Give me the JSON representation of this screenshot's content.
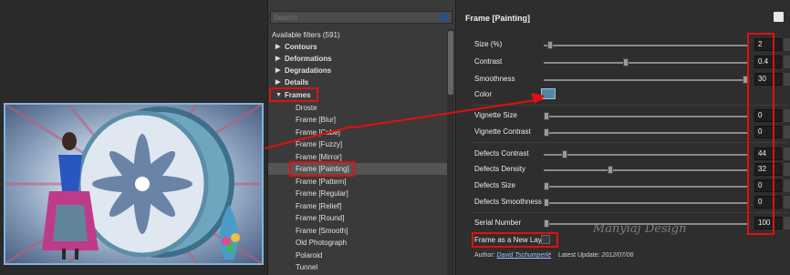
{
  "tree": {
    "search_placeholder": "Search",
    "available": "Available filters (591)",
    "categories": [
      "Contours",
      "Deformations",
      "Degradations",
      "Details",
      "Frames"
    ],
    "frames": [
      "Droste",
      "Frame [Blur]",
      "Frame [Cube]",
      "Frame [Fuzzy]",
      "Frame [Mirror]",
      "Frame [Painting]",
      "Frame [Pattern]",
      "Frame [Regular]",
      "Frame [Relief]",
      "Frame [Round]",
      "Frame [Smooth]",
      "Old Photograph",
      "Polaroid",
      "Tunnel"
    ],
    "selected": "Frame [Painting]"
  },
  "settings": {
    "title": "Frame [Painting]",
    "params": [
      {
        "label": "Size (%)",
        "value": "2",
        "pos": 0.02
      },
      {
        "label": "Contrast",
        "value": "0.4",
        "pos": 0.4
      },
      {
        "label": "Smoothness",
        "value": "30",
        "pos": 1.0
      },
      {
        "label": "Color",
        "value": "",
        "pos": null
      },
      {
        "label": "Vignette Size",
        "value": "0",
        "pos": 0.0
      },
      {
        "label": "Vignette Contrast",
        "value": "0",
        "pos": 0.0
      },
      {
        "label": "Defects Contrast",
        "value": "44",
        "pos": 0.09
      },
      {
        "label": "Defects Density",
        "value": "32",
        "pos": 0.32
      },
      {
        "label": "Defects Size",
        "value": "0",
        "pos": 0.0
      },
      {
        "label": "Defects Smoothness",
        "value": "0",
        "pos": 0.0
      },
      {
        "label": "Serial Number",
        "value": "100",
        "pos": 0.0
      }
    ],
    "new_layer_label": "Frame as a New Layer",
    "author_label": "Author:",
    "author_name": "David Tschumperlé",
    "update_label": "Latest Update:",
    "update_date": "2012/07/06",
    "signature": "Manyiaj Design",
    "color_value": "#4e8aa8"
  }
}
